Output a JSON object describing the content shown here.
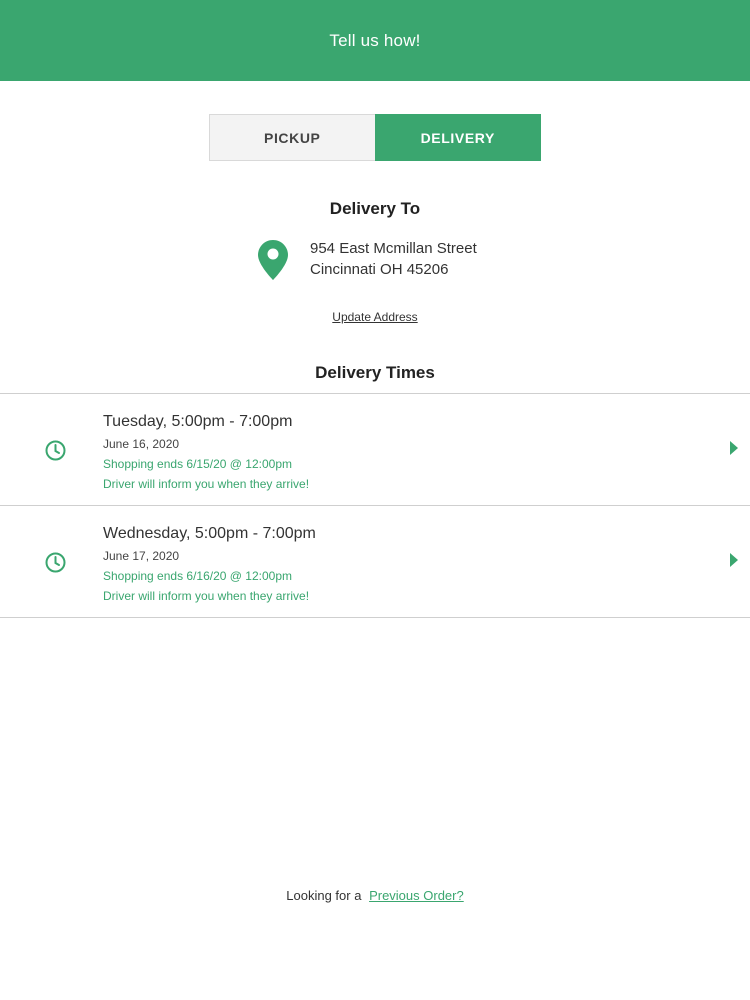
{
  "header": {
    "title": "Tell us how!"
  },
  "fulfillment_toggle": {
    "options": [
      {
        "label": "PICKUP",
        "selected": false
      },
      {
        "label": "DELIVERY",
        "selected": true
      }
    ]
  },
  "delivery_to": {
    "heading": "Delivery To",
    "address_line1": "954 East Mcmillan Street",
    "address_line2": "Cincinnati OH 45206",
    "update_label": "Update Address"
  },
  "delivery_times": {
    "heading": "Delivery Times",
    "slots": [
      {
        "title": "Tuesday, 5:00pm - 7:00pm",
        "date": "June 16, 2020",
        "shopping_ends": "Shopping ends 6/15/20 @ 12:00pm",
        "driver_note": "Driver will inform you when they arrive!"
      },
      {
        "title": "Wednesday, 5:00pm - 7:00pm",
        "date": "June 17, 2020",
        "shopping_ends": "Shopping ends 6/16/20 @ 12:00pm",
        "driver_note": "Driver will inform you when they arrive!"
      }
    ]
  },
  "footer": {
    "prefix": "Looking for a",
    "link_label": "Previous Order?"
  },
  "icons": {
    "location": "map-pin-icon",
    "clock": "clock-icon",
    "arrow": "chevron-right-icon"
  },
  "colors": {
    "brand_green": "#3aa66f",
    "toggle_inactive_bg": "#f3f3f3",
    "divider": "#cfcfcf"
  }
}
